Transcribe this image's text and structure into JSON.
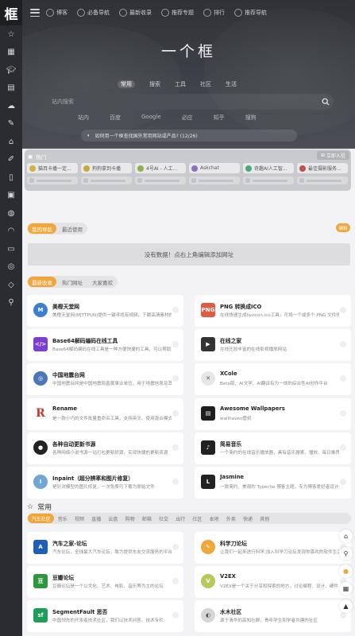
{
  "sidebar": {
    "logo_text": "框",
    "icons": [
      "star-icon",
      "calendar-icon",
      "graduation-cap-icon",
      "document-icon",
      "cloud-upload-icon",
      "wrench-icon",
      "code-icon",
      "edit-icon",
      "book-icon",
      "image-icon",
      "gamepad-icon",
      "headphones-icon",
      "monitor-icon",
      "target-icon",
      "tag-icon",
      "search-icon"
    ]
  },
  "topnav": {
    "items": [
      {
        "label": "博客",
        "icon": "blog-icon"
      },
      {
        "label": "必备导航",
        "icon": "compass-icon"
      },
      {
        "label": "最新收录",
        "icon": "clock-icon"
      },
      {
        "label": "推荐专题",
        "icon": "topic-icon"
      },
      {
        "label": "排行",
        "icon": "rank-icon"
      },
      {
        "label": "推荐导航",
        "icon": "nav-icon"
      }
    ]
  },
  "hero": {
    "title": "一个框",
    "search_tabs": [
      "常用",
      "搜索",
      "工具",
      "社区",
      "生活"
    ],
    "search_placeholder": "站内搜索",
    "engines": [
      "站内",
      "百度",
      "Google",
      "必应",
      "知乎",
      "搜狗"
    ],
    "notice": "如何用一个框查找国外常用网站或产品? (12/26)"
  },
  "hotbox": {
    "title": "热门",
    "join_label": "立即入驻",
    "items": [
      {
        "label": "猫耳卡播一定...",
        "color": "#d4b340"
      },
      {
        "label": "狗狗拿到卡播",
        "color": "#c9a83a"
      },
      {
        "label": "4号AI - 人工...",
        "color": "#8fb04a"
      },
      {
        "label": "Askchat",
        "color": "#8d6fc2"
      },
      {
        "label": "奇趣AI人工智...",
        "color": "#4aa87a"
      },
      {
        "label": "最佳摄影服务...",
        "color": "#c0504d"
      }
    ]
  },
  "mynav": {
    "tabs": [
      "我的导航",
      "最近使用"
    ],
    "active": 0,
    "more_label": "编辑",
    "empty_text": "没有数据！点右上角编辑添加网址"
  },
  "hot_section": {
    "tabs": [
      "最新收录",
      "热门网址",
      "大家喜欢"
    ],
    "active": 0,
    "cards": [
      {
        "title": "美橙天堂网",
        "desc": "美橙天堂网(MJTTPUN)提供一键寻找有视频、下载高清素材的",
        "icon": "meicheng-logo-icon",
        "icon_text": "M",
        "color": "#3b7fd4"
      },
      {
        "title": "PNG 转换成ICO",
        "desc": "在线快速生成favicon.ico工具，可将一个或多个 PNG 文件快速",
        "icon": "png-logo-icon",
        "icon_text": "PNG",
        "color": "#e25a3f"
      },
      {
        "title": "Base64解码编码在线工具",
        "desc": "Base64解码编码在线工具是一种方便快捷的工具，可以帮助您",
        "icon": "base64-logo-icon",
        "icon_text": "</>",
        "color": "#7b3fd1"
      },
      {
        "title": "在线之家",
        "desc": "在线比较丰富的在线影视播放网站",
        "icon": "clapper-icon",
        "icon_text": "▶",
        "color": "#333333"
      },
      {
        "title": "中国地震台网",
        "desc": "中国地震台网是中国地震局直属事业单位，用于地震信息及其",
        "icon": "earthquake-logo-icon",
        "icon_text": "◎",
        "color": "#4a78b8"
      },
      {
        "title": "XCole",
        "desc": "Beta版，AI文学、AI翻译有为一体的综合性AI创作平台",
        "icon": "xcole-logo-icon",
        "icon_text": "✕",
        "color": "#e6e6e6"
      },
      {
        "title": "Rename",
        "desc": "是一款小巧的文件批量重命名工具，支持英文、使用混合模式",
        "icon": "rename-logo-icon",
        "icon_text": "R",
        "color": "#ffffff"
      },
      {
        "title": "Awesome Wallpapers",
        "desc": "wallhaven壁纸",
        "icon": "wallpaper-logo-icon",
        "icon_text": "▤",
        "color": "#1e1e1e"
      },
      {
        "title": "各种自动更新书源",
        "desc": "各种网络小说书源一站打包更新好源，实现快捷的更新资源",
        "icon": "github-icon",
        "icon_text": "●",
        "color": "#222222"
      },
      {
        "title": "简易音乐",
        "desc": "一个简约的在线音乐播放器，具有音乐搜索、播放、每日推荐",
        "icon": "music-icon",
        "icon_text": "♪",
        "color": "#222222"
      },
      {
        "title": "Inpaint（超分辨率和图片修复）",
        "desc": "是针对模型的图片修复，一次免费可下载为原始文件",
        "icon": "inpaint-logo-icon",
        "icon_text": "I",
        "color": "#6fa6d6"
      },
      {
        "title": "Jasmine",
        "desc": "一款简约、美观的 Typecho 博客主题，专为博客爱好者设计的",
        "icon": "jasmine-logo-icon",
        "icon_text": "L",
        "color": "#222222"
      }
    ]
  },
  "common_section": {
    "title": "常用",
    "categories": [
      "汽车社区",
      "音乐",
      "视频",
      "直播",
      "云盘",
      "购物",
      "邮箱",
      "社交",
      "出行",
      "社区",
      "本地",
      "外卖",
      "快递",
      "其他"
    ],
    "active": 0,
    "cards": [
      {
        "title": "汽车之家-论坛",
        "desc": "汽车论坛，全球最大汽车论坛，致力提供车友交流服务的平台",
        "icon": "autohome-logo-icon",
        "icon_text": "A",
        "color": "#1f5fb5"
      },
      {
        "title": "科学刀论坛",
        "desc": "让我们一起来进行科学,加入科学刀论坛发现你喜欢的软件生活",
        "icon": "kxd-logo-icon",
        "icon_text": "✎",
        "color": "#f0a73a"
      },
      {
        "title": "豆瓣论坛",
        "desc": "豆瓣论坛是一个以文化、艺术、电影、音乐等为主的论坛",
        "icon": "douban-logo-icon",
        "icon_text": "豆",
        "color": "#2e963d"
      },
      {
        "title": "V2EX",
        "desc": "V2EX是一个关于分享和探索的地方，讨论编程、设计、硬件",
        "icon": "v2ex-logo-icon",
        "icon_text": "V",
        "color": "#b9c75b"
      },
      {
        "title": "SegmentFault 思否",
        "desc": "中国领先的开发者技术社区，我们以技术问答、技术专栏",
        "icon": "sf-logo-icon",
        "icon_text": "sf",
        "color": "#1e9e5a"
      },
      {
        "title": "水木社区",
        "desc": "源于清华的高知社群，青年学生和学者共建的社区",
        "icon": "newsmth-logo-icon",
        "icon_text": "◐",
        "color": "#d6d6d6"
      }
    ]
  },
  "tools": [
    "home-icon",
    "search-icon",
    "theme-icon",
    "qrcode-icon",
    "arrow-up-icon"
  ]
}
